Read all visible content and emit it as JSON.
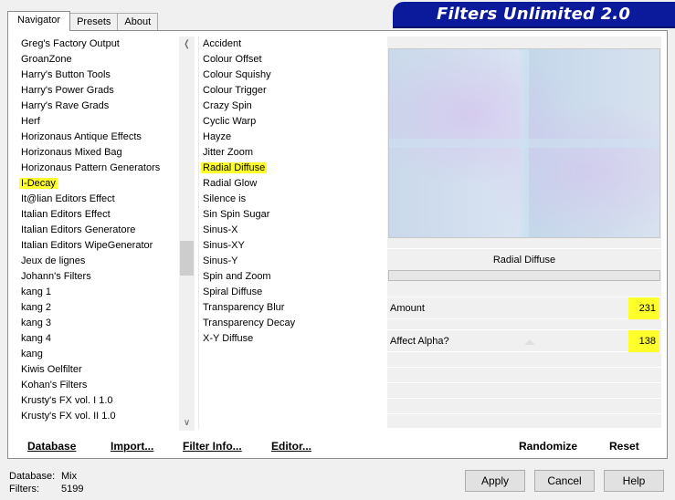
{
  "tabs": [
    "Navigator",
    "Presets",
    "About"
  ],
  "banner_title": "Filters Unlimited 2.0",
  "categories": [
    "Greg's Factory Output",
    "GroanZone",
    "Harry's Button Tools",
    "Harry's Power Grads",
    "Harry's Rave Grads",
    "Herf",
    "Horizonaus Antique Effects",
    "Horizonaus Mixed Bag",
    "Horizonaus Pattern Generators",
    "I-Decay",
    "It@lian Editors Effect",
    "Italian Editors Effect",
    "Italian Editors Generatore",
    "Italian Editors WipeGenerator",
    "Jeux de lignes",
    "Johann's Filters",
    "kang 1",
    "kang 2",
    "kang 3",
    "kang 4",
    "kang",
    "Kiwis Oelfilter",
    "Kohan's Filters",
    "Krusty's FX vol. I 1.0",
    "Krusty's FX vol. II 1.0"
  ],
  "selected_category_index": 9,
  "filters": [
    "Accident",
    "Colour Offset",
    "Colour Squishy",
    "Colour Trigger",
    "Crazy Spin",
    "Cyclic Warp",
    "Hayze",
    "Jitter Zoom",
    "Radial Diffuse",
    "Radial Glow",
    "Silence is",
    "Sin Spin Sugar",
    "Sinus-X",
    "Sinus-XY",
    "Sinus-Y",
    "Spin and Zoom",
    "Spiral Diffuse",
    "Transparency Blur",
    "Transparency Decay",
    "X-Y Diffuse"
  ],
  "selected_filter_index": 8,
  "selected_filter_name": "Radial Diffuse",
  "params": [
    {
      "label": "Amount",
      "value": "231"
    },
    {
      "label": "Affect Alpha?",
      "value": "138"
    }
  ],
  "bottom_links": {
    "database": "Database",
    "import": "Import...",
    "filter_info": "Filter Info...",
    "editor": "Editor...",
    "randomize": "Randomize",
    "reset": "Reset"
  },
  "status": {
    "database_label": "Database:",
    "database_value": "Mix",
    "filters_label": "Filters:",
    "filters_value": "5199"
  },
  "buttons": {
    "apply": "Apply",
    "cancel": "Cancel",
    "help": "Help"
  },
  "colors": {
    "highlight": "#ffff2b",
    "banner": "#0a1a9a"
  }
}
